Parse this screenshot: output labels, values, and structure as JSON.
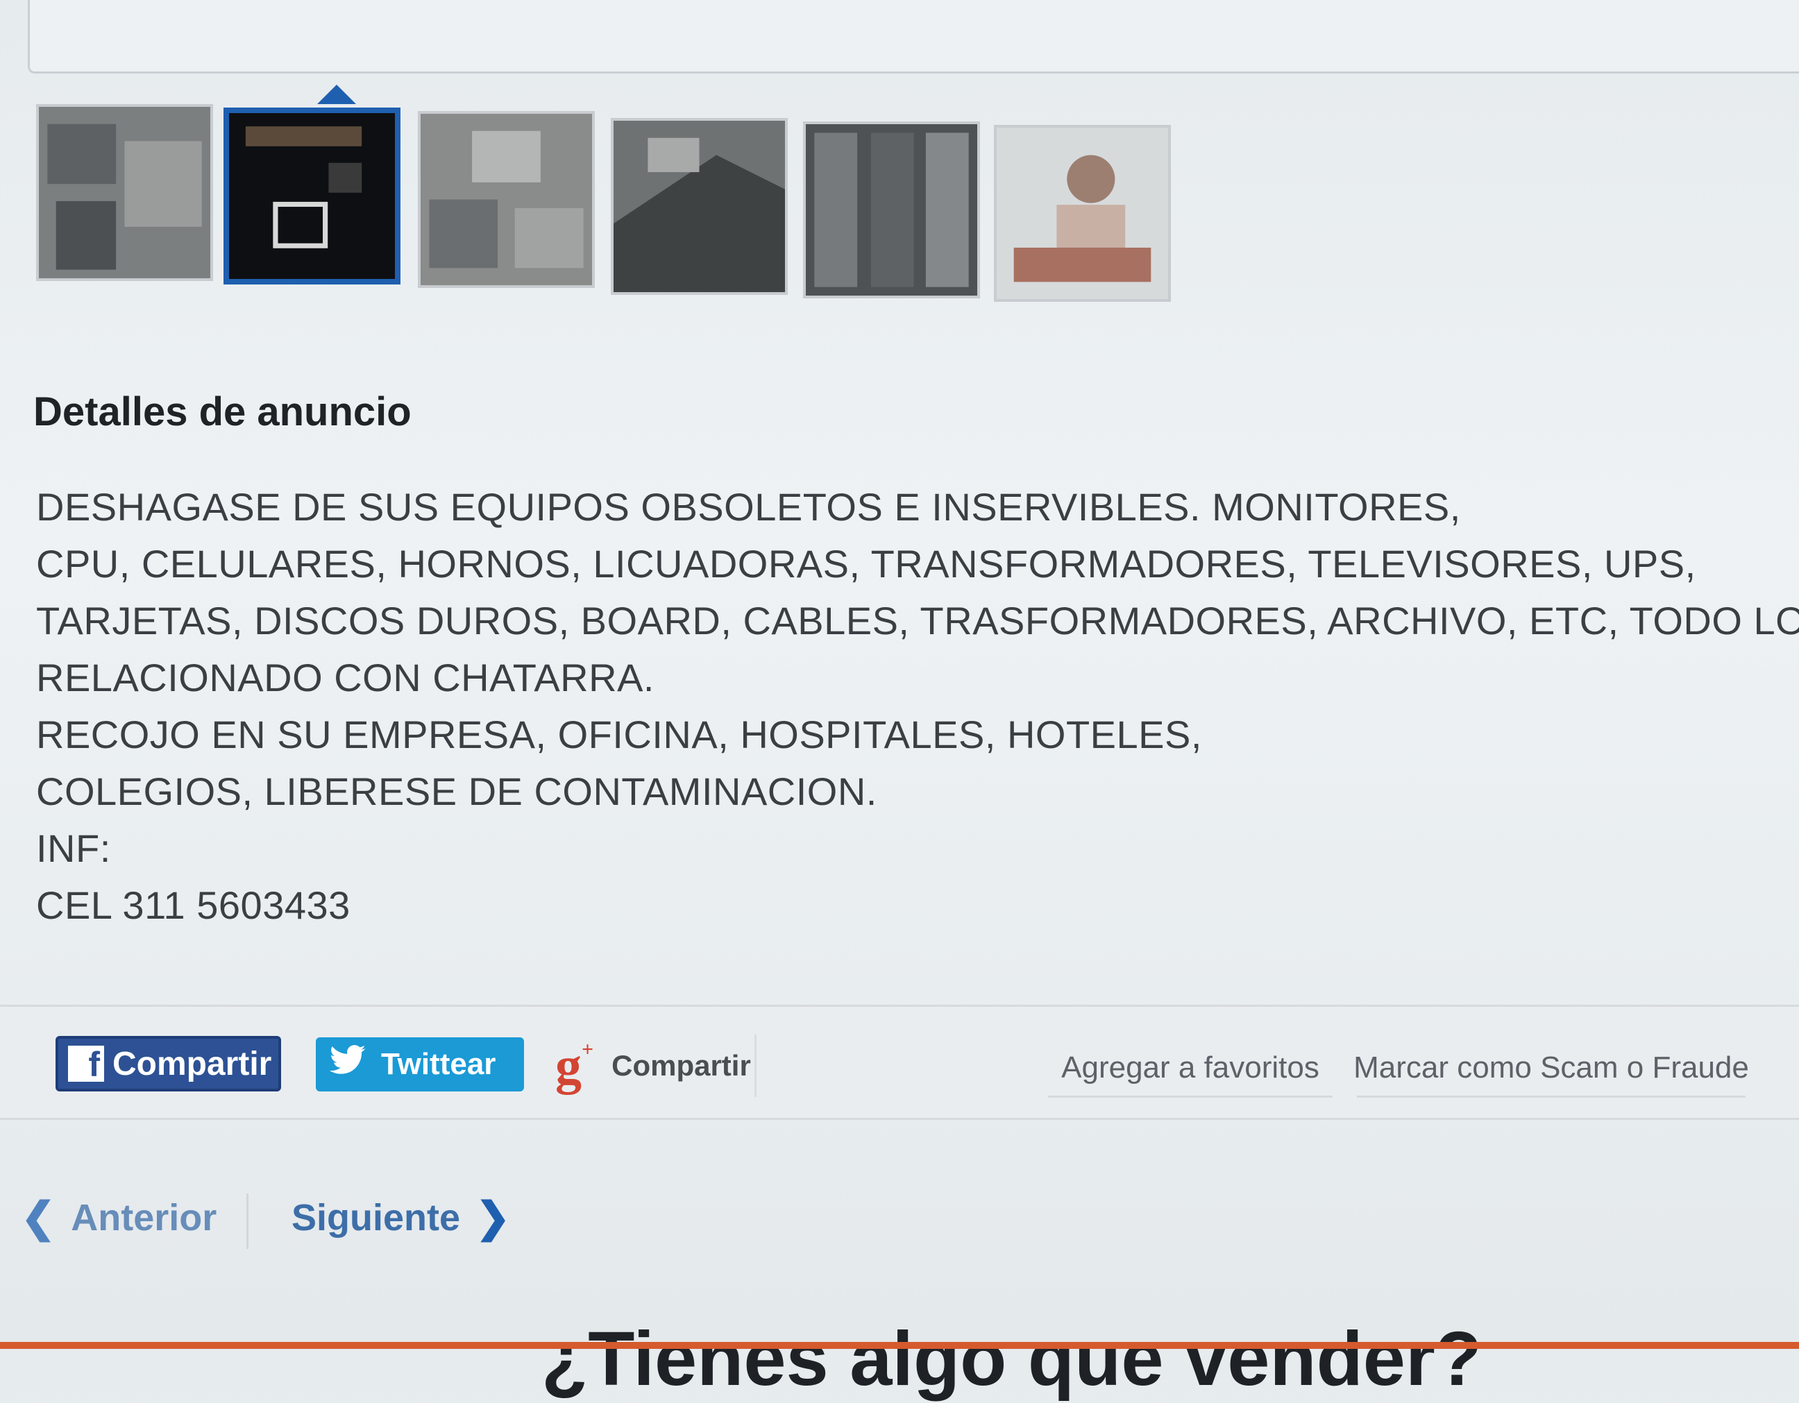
{
  "gallery": {
    "thumbnails": [
      "photo-1",
      "photo-2",
      "photo-3",
      "photo-4",
      "photo-5",
      "photo-6"
    ],
    "active_index": 1
  },
  "details": {
    "title": "Detalles de anuncio",
    "lines": [
      "DESHAGASE DE SUS EQUIPOS OBSOLETOS E INSERVIBLES. MONITORES,",
      "CPU, CELULARES, HORNOS, LICUADORAS, TRANSFORMADORES, TELEVISORES, UPS,",
      "TARJETAS, DISCOS DUROS, BOARD, CABLES, TRASFORMADORES, ARCHIVO, ETC, TODO LO",
      "RELACIONADO CON CHATARRA.",
      "RECOJO EN SU EMPRESA, OFICINA, HOSPITALES, HOTELES,",
      "COLEGIOS, LIBERESE DE CONTAMINACION.",
      "INF:",
      "CEL 311 5603433"
    ]
  },
  "share": {
    "facebook_label": "Compartir",
    "twitter_label": "Twittear",
    "gplus_label": "Compartir",
    "favorites_label": "Agregar a favoritos",
    "report_label": "Marcar como Scam o Fraude",
    "colors": {
      "facebook": "#2d5194",
      "twitter": "#1b9ad6",
      "gplus": "#d24532"
    }
  },
  "pager": {
    "prev_label": "Anterior",
    "next_label": "Siguiente"
  },
  "footer": {
    "heading": "¿Tienes algo que vender?"
  }
}
